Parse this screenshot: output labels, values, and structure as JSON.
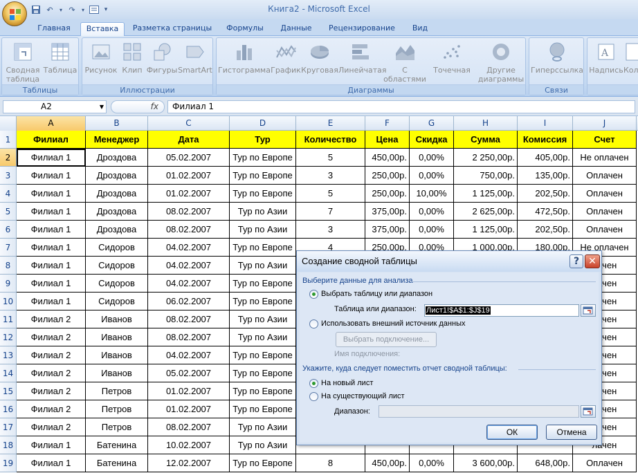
{
  "window": {
    "title": "Книга2 - Microsoft Excel"
  },
  "tabs": [
    "Главная",
    "Вставка",
    "Разметка страницы",
    "Формулы",
    "Данные",
    "Рецензирование",
    "Вид"
  ],
  "active_tab": "Вставка",
  "ribbon": {
    "groups": [
      {
        "label": "Таблицы",
        "buttons": [
          {
            "label1": "Сводная",
            "label2": "таблица",
            "icon": "pivot-table-icon"
          },
          {
            "label1": "Таблица",
            "label2": "",
            "icon": "table-icon"
          }
        ]
      },
      {
        "label": "Иллюстрации",
        "buttons": [
          {
            "label1": "Рисунок",
            "label2": "",
            "icon": "picture-icon"
          },
          {
            "label1": "Клип",
            "label2": "",
            "icon": "clipart-icon"
          },
          {
            "label1": "Фигуры",
            "label2": "",
            "icon": "shapes-icon"
          },
          {
            "label1": "SmartArt",
            "label2": "",
            "icon": "smartart-icon"
          }
        ]
      },
      {
        "label": "Диаграммы",
        "buttons": [
          {
            "label1": "Гистограмма",
            "label2": "",
            "icon": "column-chart-icon"
          },
          {
            "label1": "График",
            "label2": "",
            "icon": "line-chart-icon"
          },
          {
            "label1": "Круговая",
            "label2": "",
            "icon": "pie-chart-icon"
          },
          {
            "label1": "Линейчатая",
            "label2": "",
            "icon": "bar-chart-icon"
          },
          {
            "label1": "С",
            "label2": "областями",
            "icon": "area-chart-icon"
          },
          {
            "label1": "Точечная",
            "label2": "",
            "icon": "scatter-chart-icon"
          },
          {
            "label1": "Другие",
            "label2": "диаграммы",
            "icon": "other-charts-icon"
          }
        ]
      },
      {
        "label": "Связи",
        "buttons": [
          {
            "label1": "Гиперссылка",
            "label2": "",
            "icon": "hyperlink-icon"
          }
        ]
      },
      {
        "label": "",
        "buttons": [
          {
            "label1": "Надпись",
            "label2": "",
            "icon": "textbox-icon"
          },
          {
            "label1": "Кол",
            "label2": "",
            "icon": "header-footer-icon"
          }
        ]
      }
    ]
  },
  "formula_bar": {
    "name_box": "A2",
    "fx": "fx",
    "formula": "Филиал 1"
  },
  "columns": [
    "A",
    "B",
    "C",
    "D",
    "E",
    "F",
    "G",
    "H",
    "I",
    "J"
  ],
  "sheet": {
    "header": [
      "Филиал",
      "Менеджер",
      "Дата",
      "Тур",
      "Количество",
      "Цена",
      "Скидка",
      "Сумма",
      "Комиссия",
      "Счет"
    ],
    "rows": [
      [
        "Филиал 1",
        "Дроздова",
        "05.02.2007",
        "Тур по Европе",
        "5",
        "450,00р.",
        "0,00%",
        "2 250,00р.",
        "405,00р.",
        "Не оплачен"
      ],
      [
        "Филиал 1",
        "Дроздова",
        "01.02.2007",
        "Тур по Европе",
        "3",
        "250,00р.",
        "0,00%",
        "750,00р.",
        "135,00р.",
        "Оплачен"
      ],
      [
        "Филиал 1",
        "Дроздова",
        "01.02.2007",
        "Тур по Европе",
        "5",
        "250,00р.",
        "10,00%",
        "1 125,00р.",
        "202,50р.",
        "Оплачен"
      ],
      [
        "Филиал 1",
        "Дроздова",
        "08.02.2007",
        "Тур по Азии",
        "7",
        "375,00р.",
        "0,00%",
        "2 625,00р.",
        "472,50р.",
        "Оплачен"
      ],
      [
        "Филиал 1",
        "Дроздова",
        "08.02.2007",
        "Тур по Азии",
        "3",
        "375,00р.",
        "0,00%",
        "1 125,00р.",
        "202,50р.",
        "Оплачен"
      ],
      [
        "Филиал 1",
        "Сидоров",
        "04.02.2007",
        "Тур по Европе",
        "4",
        "250,00р.",
        "0,00%",
        "1 000,00р.",
        "180,00р.",
        "Не оплачен"
      ],
      [
        "Филиал 1",
        "Сидоров",
        "04.02.2007",
        "Тур по Азии",
        "",
        "",
        "",
        "",
        "",
        "лачен"
      ],
      [
        "Филиал 1",
        "Сидоров",
        "04.02.2007",
        "Тур по Европе",
        "",
        "",
        "",
        "",
        "",
        "лачен"
      ],
      [
        "Филиал 1",
        "Сидоров",
        "06.02.2007",
        "Тур по Европе",
        "",
        "",
        "",
        "",
        "",
        "лачен"
      ],
      [
        "Филиал 2",
        "Иванов",
        "08.02.2007",
        "Тур по Азии",
        "",
        "",
        "",
        "",
        "",
        "лачен"
      ],
      [
        "Филиал 2",
        "Иванов",
        "08.02.2007",
        "Тур по Азии",
        "",
        "",
        "",
        "",
        "",
        "лачен"
      ],
      [
        "Филиал 2",
        "Иванов",
        "04.02.2007",
        "Тур по Европе",
        "",
        "",
        "",
        "",
        "",
        "лачен"
      ],
      [
        "Филиал 2",
        "Иванов",
        "05.02.2007",
        "Тур по Европе",
        "",
        "",
        "",
        "",
        "",
        "лачен"
      ],
      [
        "Филиал 2",
        "Петров",
        "01.02.2007",
        "Тур по Европе",
        "",
        "",
        "",
        "",
        "",
        "лачен"
      ],
      [
        "Филиал 2",
        "Петров",
        "01.02.2007",
        "Тур по Европе",
        "",
        "",
        "",
        "",
        "",
        "лачен"
      ],
      [
        "Филиал 2",
        "Петров",
        "08.02.2007",
        "Тур по Азии",
        "",
        "",
        "",
        "",
        "",
        "лачен"
      ],
      [
        "Филиал 1",
        "Батенина",
        "10.02.2007",
        "Тур по Азии",
        "",
        "",
        "",
        "",
        "",
        "лачен"
      ],
      [
        "Филиал 1",
        "Батенина",
        "12.02.2007",
        "Тур по Европе",
        "8",
        "450,00р.",
        "0,00%",
        "3 600,00р.",
        "648,00р.",
        "Оплачен"
      ]
    ]
  },
  "dialog": {
    "title": "Создание сводной таблицы",
    "help": "?",
    "close": "✕",
    "section1": "Выберите данные для анализа",
    "opt_range": "Выбрать таблицу или диапазон",
    "range_label": "Таблица или диапазон:",
    "range_value": "Лист1!$A$1:$J$19",
    "opt_external": "Использовать внешний источник данных",
    "choose_connection": "Выбрать подключение...",
    "connection_name": "Имя подключения:",
    "section2": "Укажите, куда следует поместить отчет сводной таблицы:",
    "opt_new_sheet": "На новый лист",
    "opt_existing_sheet": "На существующий лист",
    "range2_label": "Диапазон:",
    "ok": "ОК",
    "cancel": "Отмена"
  }
}
